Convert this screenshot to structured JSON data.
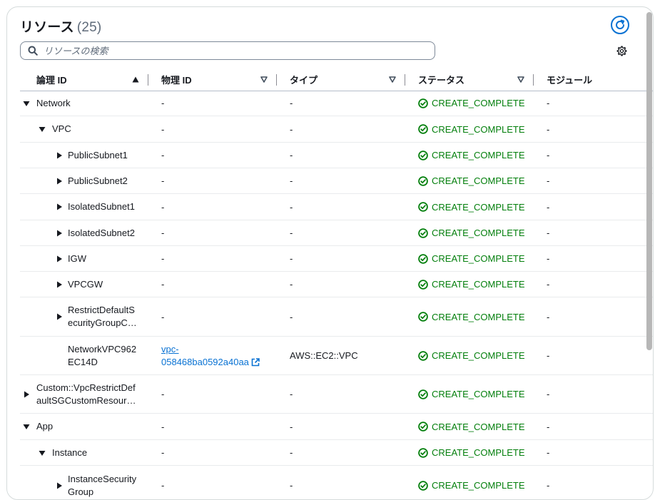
{
  "header": {
    "title": "リソース",
    "count": "(25)"
  },
  "search": {
    "placeholder": "リソースの検索"
  },
  "columns": [
    {
      "label": "論理 ID",
      "sort": "asc"
    },
    {
      "label": "物理 ID",
      "sort": "none"
    },
    {
      "label": "タイプ",
      "sort": "none"
    },
    {
      "label": "ステータス",
      "sort": "none"
    },
    {
      "label": "モジュール",
      "sort": ""
    }
  ],
  "rows": [
    {
      "name": "Network",
      "level": 0,
      "toggle": "expanded",
      "physical_id": "-",
      "type": "-",
      "status": "CREATE_COMPLETE",
      "module": "-"
    },
    {
      "name": "VPC",
      "level": 1,
      "toggle": "expanded",
      "physical_id": "-",
      "type": "-",
      "status": "CREATE_COMPLETE",
      "module": "-"
    },
    {
      "name": "PublicSubnet1",
      "level": 2,
      "toggle": "collapsed",
      "physical_id": "-",
      "type": "-",
      "status": "CREATE_COMPLETE",
      "module": "-"
    },
    {
      "name": "PublicSubnet2",
      "level": 2,
      "toggle": "collapsed",
      "physical_id": "-",
      "type": "-",
      "status": "CREATE_COMPLETE",
      "module": "-"
    },
    {
      "name": "IsolatedSubnet1",
      "level": 2,
      "toggle": "collapsed",
      "physical_id": "-",
      "type": "-",
      "status": "CREATE_COMPLETE",
      "module": "-"
    },
    {
      "name": "IsolatedSubnet2",
      "level": 2,
      "toggle": "collapsed",
      "physical_id": "-",
      "type": "-",
      "status": "CREATE_COMPLETE",
      "module": "-"
    },
    {
      "name": "IGW",
      "level": 2,
      "toggle": "collapsed",
      "physical_id": "-",
      "type": "-",
      "status": "CREATE_COMPLETE",
      "module": "-"
    },
    {
      "name": "VPCGW",
      "level": 2,
      "toggle": "collapsed",
      "physical_id": "-",
      "type": "-",
      "status": "CREATE_COMPLETE",
      "module": "-"
    },
    {
      "name_lines": [
        "RestrictDefaultS",
        "ecurityGroupC…"
      ],
      "level": 2,
      "toggle": "collapsed",
      "physical_id": "-",
      "type": "-",
      "status": "CREATE_COMPLETE",
      "module": "-"
    },
    {
      "name_lines": [
        "NetworkVPC962",
        "EC14D"
      ],
      "level": 2,
      "toggle": "none",
      "physical_id_link": [
        "vpc-",
        "058468ba0592a40aa"
      ],
      "type": "AWS::EC2::VPC",
      "status": "CREATE_COMPLETE",
      "module": "-"
    },
    {
      "name_lines": [
        "Custom::VpcRestrictDef",
        "aultSGCustomResour…"
      ],
      "level": 0,
      "toggle": "collapsed",
      "physical_id": "-",
      "type": "-",
      "status": "CREATE_COMPLETE",
      "module": "-"
    },
    {
      "name": "App",
      "level": 0,
      "toggle": "expanded",
      "physical_id": "-",
      "type": "-",
      "status": "CREATE_COMPLETE",
      "module": "-"
    },
    {
      "name": "Instance",
      "level": 1,
      "toggle": "expanded",
      "physical_id": "-",
      "type": "-",
      "status": "CREATE_COMPLETE",
      "module": "-"
    },
    {
      "name_lines": [
        "InstanceSecurity",
        "Group"
      ],
      "level": 2,
      "toggle": "collapsed",
      "physical_id": "-",
      "type": "-",
      "status": "CREATE_COMPLETE",
      "module": "-"
    }
  ],
  "colors": {
    "accent": "#0972d3",
    "success": "#037f0c",
    "text": "#16191f",
    "muted": "#5f6b7a"
  },
  "icons": {
    "refresh": "refresh-icon",
    "search": "search-icon",
    "settings": "gear-icon",
    "status": "check-circle-icon",
    "external": "external-link-icon"
  }
}
